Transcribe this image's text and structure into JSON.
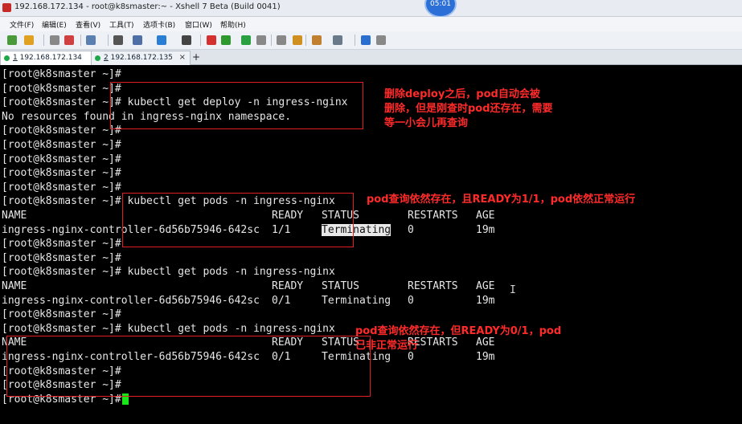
{
  "window": {
    "title": "192.168.172.134 - root@k8smaster:~ - Xshell 7 Beta (Build 0041)",
    "overlay_badge": "05:01"
  },
  "menu": [
    {
      "label": "文件(F)"
    },
    {
      "label": "编辑(E)"
    },
    {
      "label": "查看(V)"
    },
    {
      "label": "工具(T)"
    },
    {
      "label": "选项卡(B)"
    },
    {
      "label": "窗口(W)"
    },
    {
      "label": "帮助(H)"
    }
  ],
  "toolbar": [
    {
      "icon": "new-session-icon",
      "color": "#4a9a3a"
    },
    {
      "icon": "open-folder-icon",
      "color": "#e0a020"
    },
    {
      "icon": "disconnect-icon",
      "color": "#888888"
    },
    {
      "icon": "reconnect-icon",
      "color": "#d04040"
    },
    {
      "icon": "properties-icon",
      "color": "#5a7fb0"
    },
    {
      "icon": "find-icon",
      "color": "#555555"
    },
    {
      "icon": "print-icon",
      "color": "#4d6fa5"
    },
    {
      "icon": "globe-icon",
      "color": "#2a7fd4"
    },
    {
      "icon": "font-icon",
      "color": "#444444"
    },
    {
      "icon": "xftp-icon",
      "color": "#d43030"
    },
    {
      "icon": "xmanager-icon",
      "color": "#2e9a2e"
    },
    {
      "icon": "fullscreen-icon",
      "color": "#2aa040"
    },
    {
      "icon": "lock-icon",
      "color": "#888888"
    },
    {
      "icon": "keyboard-icon",
      "color": "#888888"
    },
    {
      "icon": "compose-icon",
      "color": "#d09020"
    },
    {
      "icon": "tunnel-icon",
      "color": "#c08030"
    },
    {
      "icon": "layout-icon",
      "color": "#6a7a8a"
    },
    {
      "icon": "help-icon",
      "color": "#2a6fd0"
    },
    {
      "icon": "chat-icon",
      "color": "#888888"
    }
  ],
  "tabs": [
    {
      "index": "1",
      "label": "192.168.172.134",
      "active": true
    },
    {
      "index": "2",
      "label": "192.168.172.135",
      "active": false
    }
  ],
  "terminal": {
    "prompt": "[root@k8smaster ~]#",
    "columns": {
      "name": "NAME",
      "ready": "READY",
      "status": "STATUS",
      "restarts": "RESTARTS",
      "age": "AGE"
    },
    "lines": [
      {
        "type": "prompt",
        "command": ""
      },
      {
        "type": "prompt",
        "command": ""
      },
      {
        "type": "prompt",
        "command": " kubectl get deploy -n ingress-nginx"
      },
      {
        "type": "output",
        "text": "No resources found in ingress-nginx namespace."
      },
      {
        "type": "prompt",
        "command": ""
      },
      {
        "type": "prompt",
        "command": ""
      },
      {
        "type": "prompt",
        "command": ""
      },
      {
        "type": "prompt",
        "command": ""
      },
      {
        "type": "prompt",
        "command": ""
      },
      {
        "type": "prompt",
        "command": " kubectl get pods -n ingress-nginx"
      },
      {
        "type": "header"
      },
      {
        "type": "row",
        "name": "ingress-nginx-controller-6d56b75946-642sc",
        "ready": "1/1",
        "status": "Terminating",
        "restarts": "0",
        "age": "19m",
        "selected": true
      },
      {
        "type": "prompt",
        "command": ""
      },
      {
        "type": "prompt",
        "command": ""
      },
      {
        "type": "prompt",
        "command": " kubectl get pods -n ingress-nginx"
      },
      {
        "type": "header"
      },
      {
        "type": "row",
        "name": "ingress-nginx-controller-6d56b75946-642sc",
        "ready": "0/1",
        "status": "Terminating",
        "restarts": "0",
        "age": "19m",
        "selected": false
      },
      {
        "type": "prompt",
        "command": ""
      },
      {
        "type": "prompt",
        "command": " kubectl get pods -n ingress-nginx"
      },
      {
        "type": "header"
      },
      {
        "type": "row",
        "name": "ingress-nginx-controller-6d56b75946-642sc",
        "ready": "0/1",
        "status": "Terminating",
        "restarts": "0",
        "age": "19m",
        "selected": false
      },
      {
        "type": "prompt",
        "command": ""
      },
      {
        "type": "prompt",
        "command": ""
      },
      {
        "type": "prompt",
        "command": "",
        "cursor": true
      }
    ]
  },
  "annotations": [
    {
      "lines": [
        "删除deploy之后，pod自动会被",
        "删除，但是刚查时pod还存在，需要",
        "等一小会儿再查询"
      ]
    },
    {
      "lines": [
        "pod查询依然存在，且READY为1/1，pod依然正常运行"
      ]
    },
    {
      "lines": [
        "pod查询依然存在，但READY为0/1，pod",
        "已非正常运行"
      ]
    }
  ],
  "colors": {
    "annotation": "#ff2a2a",
    "cursor": "#19e619",
    "terminal_bg": "#000000",
    "terminal_fg": "#e6e6e6"
  }
}
